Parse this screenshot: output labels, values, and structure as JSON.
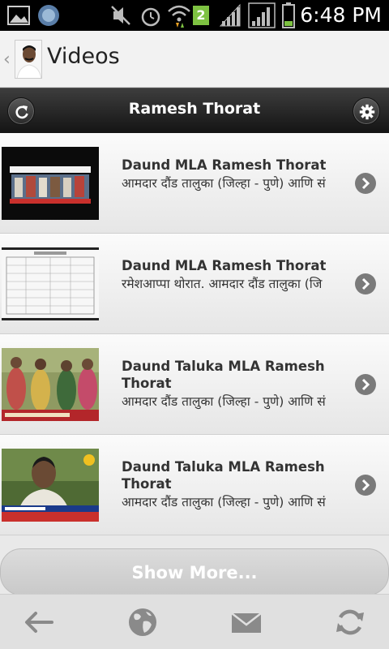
{
  "status_bar": {
    "time": "6:48 PM",
    "sim_badge": "2",
    "icons": [
      "gallery-icon",
      "app-icon",
      "mute-icon",
      "alarm-icon",
      "wifi-icon",
      "sim-icon",
      "signal-icon",
      "signal-icon",
      "battery-icon"
    ]
  },
  "action_bar": {
    "title": "Videos",
    "up_glyph": "‹",
    "icons": [
      "back-chevron-icon",
      "profile-avatar"
    ]
  },
  "header": {
    "title": "Ramesh Thorat",
    "icons": [
      "refresh-icon",
      "settings-gear-icon"
    ]
  },
  "videos": [
    {
      "title": "Daund MLA Ramesh Thorat",
      "description": "आमदार दौंड तालुका (जिल्हा - पुणे) आणि सं"
    },
    {
      "title": "Daund MLA Ramesh Thorat",
      "description": "रमेशआप्पा थोरात. आमदार दौंड तालुका (जि"
    },
    {
      "title": "Daund Taluka MLA Ramesh Thorat",
      "description": "आमदार दौंड तालुका (जिल्हा - पुणे) आणि सं"
    },
    {
      "title": "Daund Taluka MLA Ramesh Thorat",
      "description": "आमदार दौंड तालुका (जिल्हा - पुणे) आणि सं"
    }
  ],
  "show_more_label": "Show More...",
  "bottom_bar": {
    "icons": [
      "back-arrow-icon",
      "globe-icon",
      "mail-icon",
      "sync-icon"
    ]
  },
  "colors": {
    "header_bg": "#1e1e1e",
    "list_bg": "#f4f4f4",
    "chevron": "#7a7a7a",
    "bottom_icon": "#8a8a8a"
  }
}
